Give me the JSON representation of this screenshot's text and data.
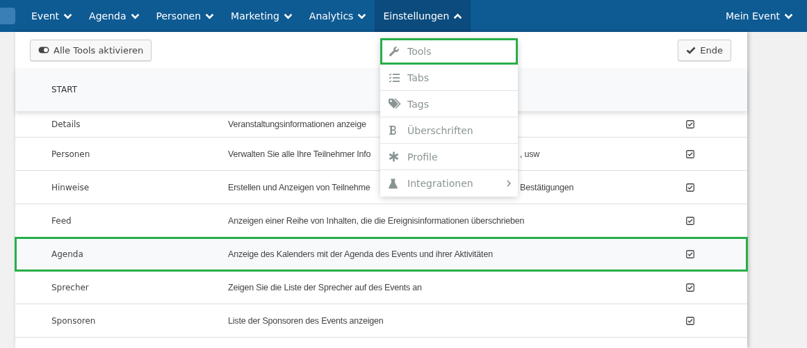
{
  "nav": {
    "items": [
      {
        "label": "Event",
        "expanded": false
      },
      {
        "label": "Agenda",
        "expanded": false
      },
      {
        "label": "Personen",
        "expanded": false
      },
      {
        "label": "Marketing",
        "expanded": false
      },
      {
        "label": "Analytics",
        "expanded": false
      },
      {
        "label": "Einstellungen",
        "expanded": true
      }
    ],
    "account": {
      "label": "Mein Event",
      "expanded": false
    }
  },
  "toolbar": {
    "toggle_button": "Alle Tools aktivieren",
    "done_button": "Ende"
  },
  "table": {
    "header": "START",
    "rows": [
      {
        "name": "Details",
        "description": "Veranstaltungsinformationen anzeige",
        "checked": true,
        "selected": false
      },
      {
        "name": "Personen",
        "description": "Verwalten Sie alle Ihre Teilnehmer Info",
        "description_right": ", usw",
        "checked": true,
        "selected": false
      },
      {
        "name": "Hinweise",
        "description": "Erstellen und Anzeigen von Teilnehme",
        "description_right": "Bestätigungen",
        "checked": true,
        "selected": false
      },
      {
        "name": "Feed",
        "description": "Anzeigen einer Reihe von Inhalten, die die Ereignisinformationen überschrieben",
        "checked": true,
        "selected": false
      },
      {
        "name": "Agenda",
        "description": "Anzeige des Kalenders mit der Agenda des Events und ihrer Aktivitäten",
        "checked": true,
        "selected": true
      },
      {
        "name": "Sprecher",
        "description": "Zeigen Sie die Liste der Sprecher auf des Events an",
        "checked": true,
        "selected": false
      },
      {
        "name": "Sponsoren",
        "description": "Liste der Sponsoren des Events anzeigen",
        "checked": true,
        "selected": false
      }
    ]
  },
  "menu": {
    "items": [
      {
        "kind": "wrench",
        "label": "Tools",
        "selected": true,
        "submenu": false
      },
      {
        "kind": "checklist",
        "label": "Tabs",
        "selected": false,
        "submenu": false
      },
      {
        "kind": "tags",
        "label": "Tags",
        "selected": false,
        "submenu": false
      },
      {
        "kind": "bold",
        "label": "Überschriften",
        "selected": false,
        "submenu": false
      },
      {
        "kind": "asterisk",
        "label": "Profile",
        "selected": false,
        "submenu": false
      },
      {
        "kind": "flask",
        "label": "Integrationen",
        "selected": false,
        "submenu": true
      }
    ]
  }
}
